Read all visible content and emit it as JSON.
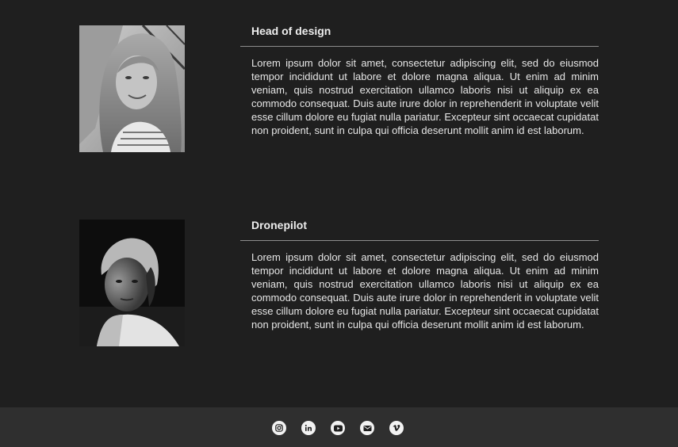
{
  "team": [
    {
      "role": "Head of design",
      "bio": "Lorem ipsum dolor sit amet, consectetur adipiscing elit, sed do eiusmod tempor incididunt ut labore et dolore magna aliqua. Ut enim ad minim veniam, quis nostrud exercitation ullamco laboris nisi ut aliquip ex ea commodo consequat. Duis aute irure dolor in reprehenderit in voluptate velit esse cillum dolore eu fugiat nulla pariatur. Excepteur sint occaecat cupidatat non proident, sunt in culpa qui officia deserunt mollit anim id est laborum."
    },
    {
      "role": "Dronepilot",
      "bio": "Lorem ipsum dolor sit amet, consectetur adipiscing elit, sed do eiusmod tempor incididunt ut labore et dolore magna aliqua. Ut enim ad minim veniam, quis nostrud exercitation ullamco laboris nisi ut aliquip ex ea commodo consequat. Duis aute irure dolor in reprehenderit in voluptate velit esse cillum dolore eu fugiat nulla pariatur. Excepteur sint occaecat cupidatat non proident, sunt in culpa qui officia deserunt mollit anim id est laborum."
    }
  ],
  "footer": {
    "social_icons": [
      "instagram-icon",
      "linkedin-icon",
      "youtube-icon",
      "email-icon",
      "vimeo-icon"
    ]
  },
  "colors": {
    "background": "#1f1f1f",
    "footer": "#2f2f2f",
    "text": "#e8e8e8",
    "divider": "#8d8d8d"
  }
}
